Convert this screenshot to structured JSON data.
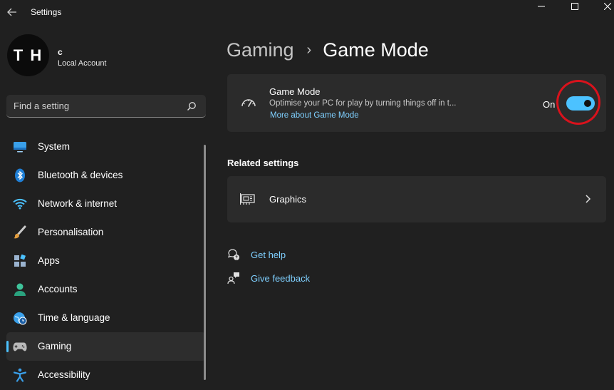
{
  "window": {
    "app_title": "Settings"
  },
  "profile": {
    "avatar_initials": "T H",
    "name": "c",
    "account_type": "Local Account"
  },
  "search": {
    "placeholder": "Find a setting"
  },
  "sidebar": {
    "items": [
      {
        "label": "System",
        "icon": "monitor-icon",
        "active": false
      },
      {
        "label": "Bluetooth & devices",
        "icon": "bluetooth-icon",
        "active": false
      },
      {
        "label": "Network & internet",
        "icon": "wifi-icon",
        "active": false
      },
      {
        "label": "Personalisation",
        "icon": "paintbrush-icon",
        "active": false
      },
      {
        "label": "Apps",
        "icon": "apps-icon",
        "active": false
      },
      {
        "label": "Accounts",
        "icon": "person-icon",
        "active": false
      },
      {
        "label": "Time & language",
        "icon": "globe-clock-icon",
        "active": false
      },
      {
        "label": "Gaming",
        "icon": "gamepad-icon",
        "active": true
      },
      {
        "label": "Accessibility",
        "icon": "accessibility-icon",
        "active": false
      }
    ]
  },
  "breadcrumb": {
    "parent": "Gaming",
    "separator": "›",
    "current": "Game Mode"
  },
  "game_mode": {
    "title": "Game Mode",
    "description": "Optimise your PC for play by turning things off in t...",
    "link": "More about Game Mode",
    "toggle_label": "On",
    "toggle_on": true
  },
  "related": {
    "title": "Related settings",
    "graphics_label": "Graphics"
  },
  "help": {
    "get_help": "Get help",
    "give_feedback": "Give feedback"
  },
  "colors": {
    "accent": "#4cc2ff",
    "background": "#202020",
    "card": "#2b2b2b",
    "link": "#7fd0ff",
    "highlight": "#d9121c"
  }
}
